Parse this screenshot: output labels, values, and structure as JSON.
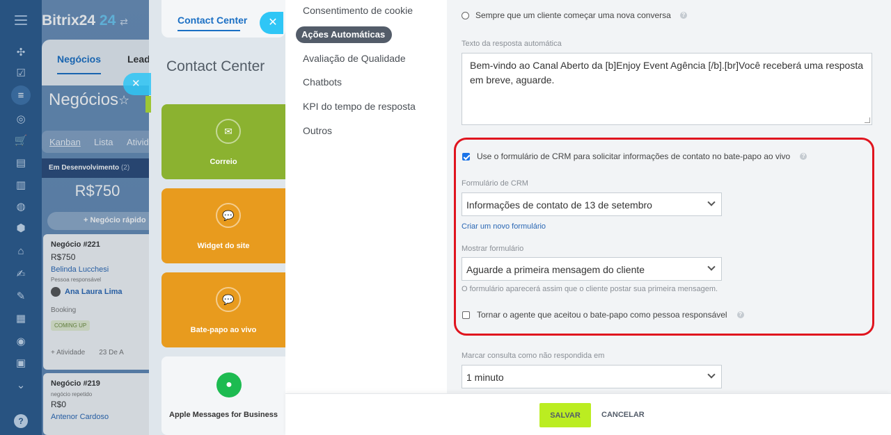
{
  "app": {
    "logo": "Bitrix24",
    "logo_suffix": "24",
    "logo_sync": "⇄"
  },
  "crm": {
    "tabs": [
      "Negócios",
      "Leads"
    ],
    "title": "Negócios",
    "views": [
      "Kanban",
      "Lista",
      "Ativid"
    ],
    "stage": {
      "name": "Em Desenvolvimento",
      "count": "(2)",
      "sum": "R$750"
    },
    "quick_deal": "+ Negócio rápido",
    "deals": [
      {
        "title": "Negócio #221",
        "value": "R$750",
        "contact": "Belinda Lucchesi",
        "role": "Pessoa responsável",
        "responsible": "Ana Laura Lima",
        "type": "Booking",
        "badge": "COMING UP",
        "activity": "+ Atividade",
        "date": "23 De A"
      },
      {
        "title": "Negócio #219",
        "note": "negócio repetido",
        "value": "R$0",
        "contact": "Antenor Cardoso"
      }
    ]
  },
  "contact_center": {
    "tab": "Contact Center",
    "heading": "Contact Center",
    "tiles": [
      {
        "label": "Correio",
        "icon": "mail-icon",
        "color": "#8bb230"
      },
      {
        "label": "Widget do site",
        "icon": "chat-icon",
        "color": "#e89b1e"
      },
      {
        "label": "Bate-papo ao vivo",
        "icon": "chat-icon",
        "color": "#e89b1e"
      },
      {
        "label": "Apple Messages for Business",
        "icon": "apple-messages-icon",
        "color": "#1dbb51"
      }
    ]
  },
  "menu": {
    "items": [
      "Consentimento de cookie",
      "Ações Automáticas",
      "Avaliação de Qualidade",
      "Chatbots",
      "KPI do tempo de resposta",
      "Outros"
    ],
    "active_index": 1
  },
  "settings": {
    "radio_option": "Sempre que um cliente começar uma nova conversa",
    "autoreply_label": "Texto da resposta automática",
    "autoreply_text": "Bem-vindo ao Canal Aberto da [b]Enjoy Event Agência [/b].[br]Você receberá uma resposta em breve, aguarde.",
    "crm_form_checkbox": "Use o formulário de CRM para solicitar informações de contato no bate-papo ao vivo",
    "crm_form_checked": true,
    "crm_form_label": "Formulário de CRM",
    "crm_form_value": "Informações de contato de 13 de setembro",
    "crm_form_new_link": "Criar um novo formulário",
    "show_form_label": "Mostrar formulário",
    "show_form_value": "Aguarde a primeira mensagem do cliente",
    "show_form_hint": "O formulário aparecerá assim que o cliente postar sua primeira mensagem.",
    "agent_checkbox": "Tornar o agente que aceitou o bate-papo como pessoa responsável",
    "agent_checked": false,
    "unanswered_label": "Marcar consulta como não respondida em",
    "unanswered_value": "1 minuto",
    "highlight_color": "#e0141e"
  },
  "footer": {
    "save": "SALVAR",
    "cancel": "CANCELAR"
  }
}
